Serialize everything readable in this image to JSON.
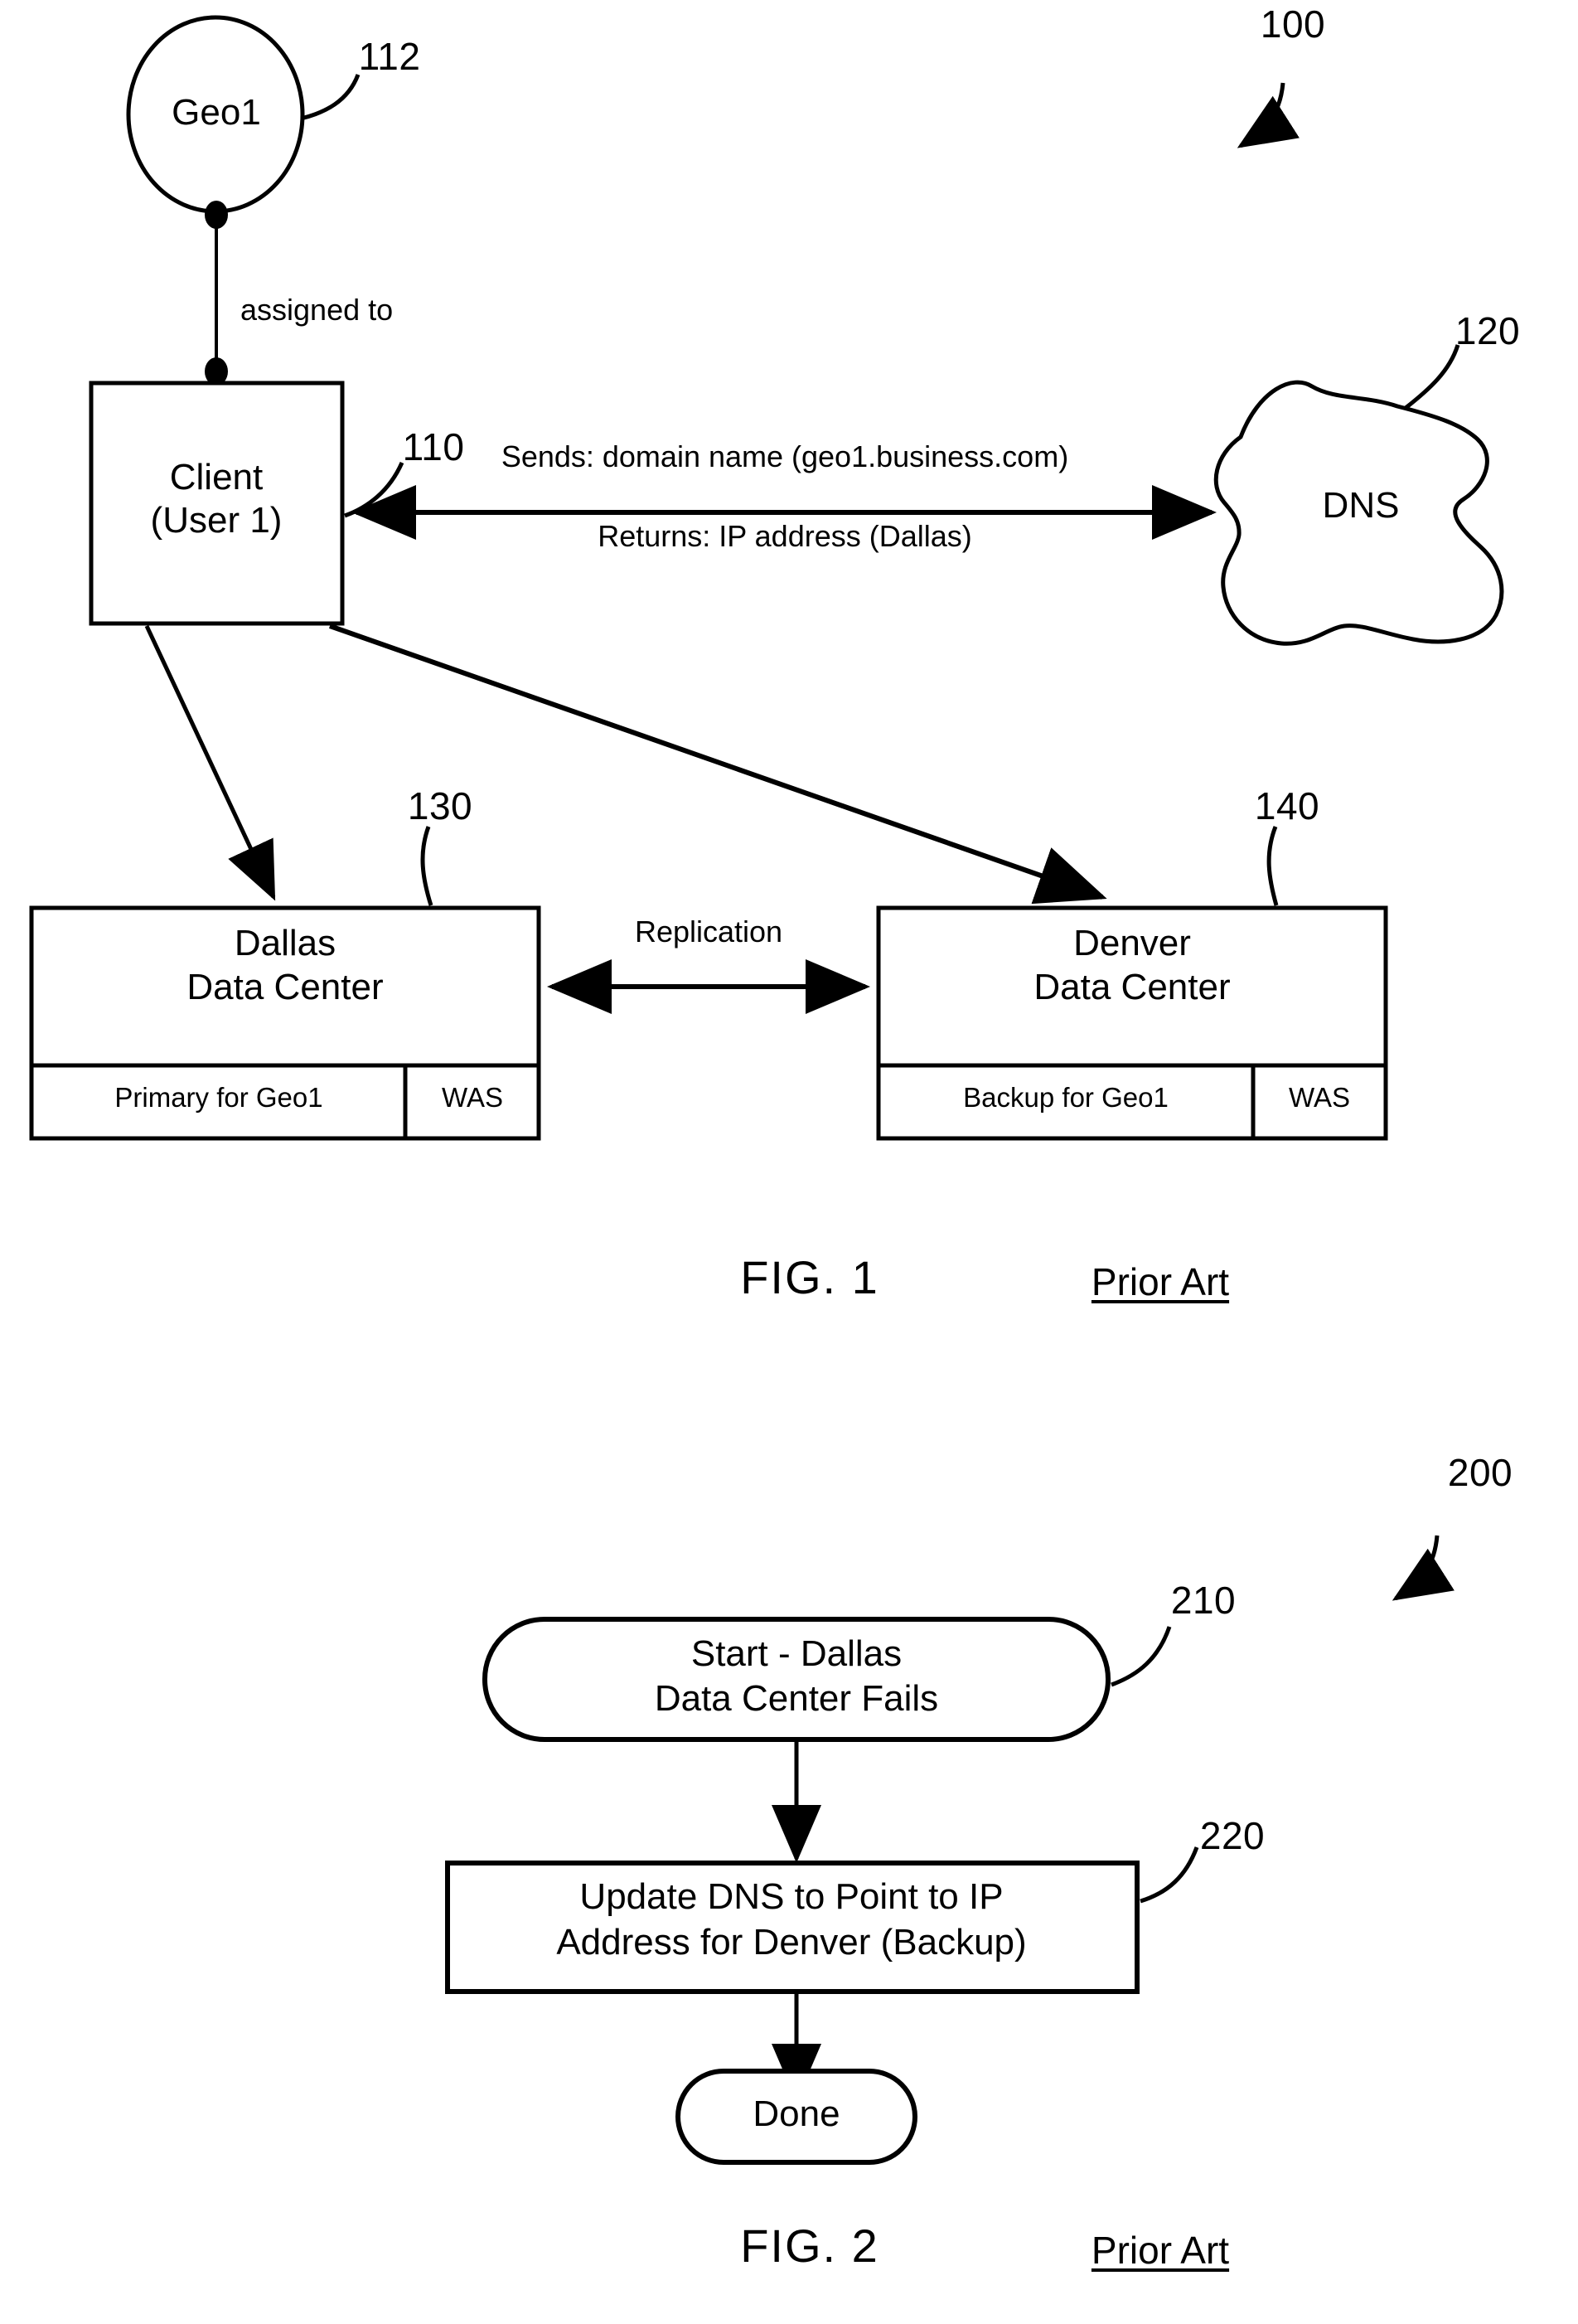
{
  "figures": [
    {
      "id": "fig1",
      "caption": "FIG. 1",
      "annotation": "Prior Art",
      "system_ref": "100",
      "nodes": {
        "geo": {
          "label": "Geo1",
          "ref": "112",
          "shape": "ellipse"
        },
        "client": {
          "line1": "Client",
          "line2": "(User 1)",
          "ref": "110",
          "shape": "rectangle"
        },
        "dns": {
          "label": "DNS",
          "ref": "120",
          "shape": "cloud"
        },
        "dallas": {
          "line1": "Dallas",
          "line2": "Data Center",
          "ref": "130",
          "role_cell": "Primary for Geo1",
          "server_cell": "WAS",
          "shape": "rectangle"
        },
        "denver": {
          "line1": "Denver",
          "line2": "Data Center",
          "ref": "140",
          "role_cell": "Backup for Geo1",
          "server_cell": "WAS",
          "shape": "rectangle"
        }
      },
      "edges": {
        "geo_to_client": "assigned to",
        "client_to_dns": "Sends: domain name (geo1.business.com)",
        "dns_to_client": "Returns: IP address (Dallas)",
        "dallas_denver": "Replication"
      }
    },
    {
      "id": "fig2",
      "caption": "FIG. 2",
      "annotation": "Prior Art",
      "system_ref": "200",
      "steps": [
        {
          "ref": "210",
          "line1": "Start - Dallas",
          "line2": "Data Center Fails",
          "shape": "stadium"
        },
        {
          "ref": "220",
          "line1": "Update DNS to Point to IP",
          "line2": "Address for Denver (Backup)",
          "shape": "rectangle"
        },
        {
          "ref": "",
          "line1": "Done",
          "line2": "",
          "shape": "stadium"
        }
      ]
    }
  ],
  "colors": {
    "ink": "#000000",
    "paper": "#ffffff"
  }
}
